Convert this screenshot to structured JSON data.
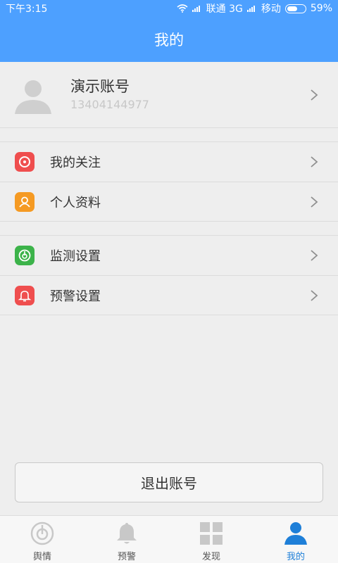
{
  "status_bar": {
    "time": "下午3:15",
    "carrier1": "联通 3G",
    "carrier2": "移动",
    "battery": "59%",
    "battery_level": 0.59
  },
  "header": {
    "title": "我的"
  },
  "profile": {
    "name": "演示账号",
    "phone": "13404144977"
  },
  "menu": {
    "group1": [
      {
        "label": "我的关注",
        "color": "#ef4e4e",
        "icon": "target-icon"
      },
      {
        "label": "个人资料",
        "color": "#f59a23",
        "icon": "person-icon"
      }
    ],
    "group2": [
      {
        "label": "监测设置",
        "color": "#3cb34a",
        "icon": "monitor-icon"
      },
      {
        "label": "预警设置",
        "color": "#ef4e4e",
        "icon": "bell-icon"
      }
    ]
  },
  "logout_label": "退出账号",
  "bottom_nav": {
    "items": [
      {
        "label": "舆情",
        "icon": "radar-icon"
      },
      {
        "label": "预警",
        "icon": "bell-icon"
      },
      {
        "label": "发现",
        "icon": "grid-icon"
      },
      {
        "label": "我的",
        "icon": "user-icon"
      }
    ],
    "active_index": 3,
    "active_color": "#1e7fd8"
  }
}
